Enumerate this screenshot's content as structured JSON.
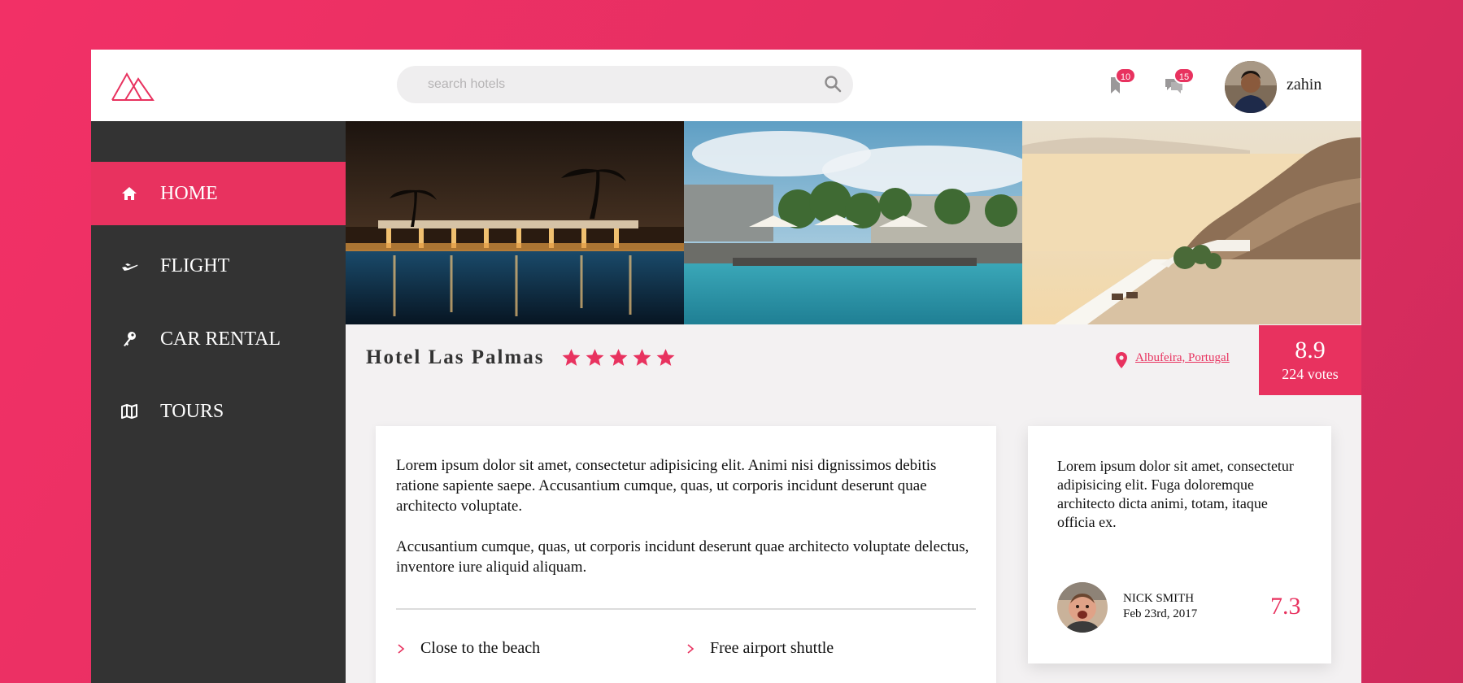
{
  "header": {
    "search_placeholder": "search hotels",
    "bookmarks_count": "10",
    "messages_count": "15",
    "username": "zahin"
  },
  "sidebar": {
    "items": [
      {
        "label": "HOME",
        "icon": "home-icon",
        "active": true
      },
      {
        "label": "FLIGHT",
        "icon": "plane-icon",
        "active": false
      },
      {
        "label": "CAR RENTAL",
        "icon": "key-icon",
        "active": false
      },
      {
        "label": "TOURS",
        "icon": "map-icon",
        "active": false
      }
    ]
  },
  "hotel": {
    "name": "Hotel Las Palmas",
    "stars": 5,
    "location": "Albufeira, Portugal",
    "score": "8.9",
    "votes": "224 votes"
  },
  "description": {
    "paragraph1": "Lorem ipsum dolor sit amet, consectetur adipisicing elit. Animi nisi dignissimos debitis ratione sapiente saepe. Accusantium cumque, quas, ut corporis incidunt deserunt quae architecto voluptate.",
    "paragraph2": "Accusantium cumque, quas, ut corporis incidunt deserunt quae architecto voluptate delectus, inventore iure aliquid aliquam.",
    "features": [
      "Close to the beach",
      "Free airport shuttle"
    ]
  },
  "review": {
    "text": "Lorem ipsum dolor sit amet, consectetur adipisicing elit. Fuga doloremque architecto dicta animi, totam, itaque officia ex.",
    "author": "NICK SMITH",
    "date": "Feb 23rd, 2017",
    "score": "7.3"
  },
  "colors": {
    "accent": "#e8325f",
    "sidebar": "#333333",
    "background": "#f3f1f2"
  }
}
